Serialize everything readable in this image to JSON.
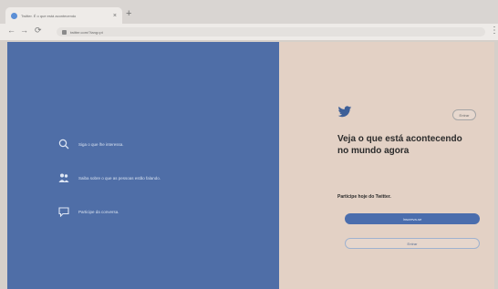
{
  "browser": {
    "tab_title": "Twitter. É o que está acontecendo",
    "tab_close": "×",
    "new_tab": "+",
    "back": "←",
    "forward": "→",
    "reload": "⟳",
    "url": "twitter.com/?lang=pt",
    "menu": "⋮"
  },
  "left_panel": {
    "color": "#4f6ea7",
    "features": [
      {
        "icon": "search-icon",
        "label": "Siga o que lhe interessa."
      },
      {
        "icon": "people-icon",
        "label": "Saiba sobre o que as pessoas estão falando."
      },
      {
        "icon": "chat-bubble-icon",
        "label": "Participe da conversa."
      }
    ]
  },
  "right_panel": {
    "login_label": "Entrar",
    "headline": "Veja o que está acontecendo no mundo agora",
    "join_label": "Participe hoje do Twitter.",
    "signup_label": "Inscreva-se",
    "enter_label": "Entrar",
    "accent": "#4a6dad"
  }
}
